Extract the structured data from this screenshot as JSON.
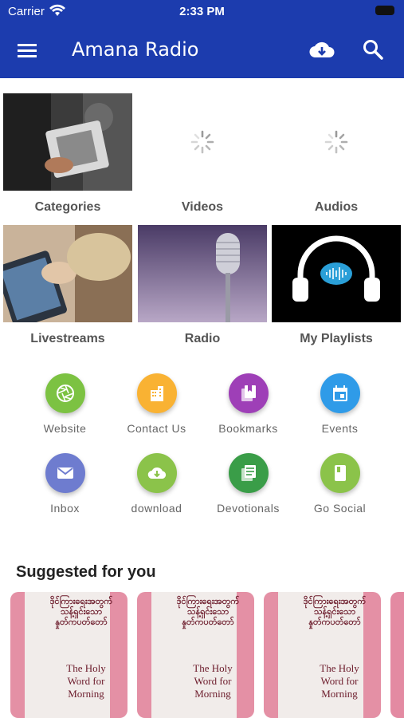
{
  "status_bar": {
    "carrier": "Carrier",
    "time": "2:33 PM"
  },
  "app_bar": {
    "title": "Amana Radio",
    "icons": [
      "menu-icon",
      "cloud-download-icon",
      "search-icon"
    ]
  },
  "tiles": [
    {
      "label": "Categories",
      "image": "person-reading-tablet"
    },
    {
      "label": "Videos",
      "image": "loading-spinner"
    },
    {
      "label": "Audios",
      "image": "loading-spinner"
    },
    {
      "label": "Livestreams",
      "image": "hand-holding-tablet"
    },
    {
      "label": "Radio",
      "image": "microphone"
    },
    {
      "label": "My Playlists",
      "image": "headphones"
    }
  ],
  "quick_actions": [
    {
      "label": "Website",
      "icon": "camera-aperture-icon",
      "color": "#7cc242"
    },
    {
      "label": "Contact Us",
      "icon": "building-icon",
      "color": "#f9b233"
    },
    {
      "label": "Bookmarks",
      "icon": "bookmark-icon",
      "color": "#9e3fb7"
    },
    {
      "label": "Events",
      "icon": "calendar-icon",
      "color": "#2f9be8"
    },
    {
      "label": "Inbox",
      "icon": "mail-icon",
      "color": "#6e7ccf"
    },
    {
      "label": "download",
      "icon": "cloud-download-icon",
      "color": "#8bc34a"
    },
    {
      "label": "Devotionals",
      "icon": "list-icon",
      "color": "#3a9d48"
    },
    {
      "label": "Go Social",
      "icon": "book-icon",
      "color": "#8bc34a"
    }
  ],
  "suggested": {
    "title": "Suggested for you",
    "cards": [
      {
        "headline": "ဒိုင်ကြားရေးအတွက် သန့်ရှင်းသော နှုတ်ကပတ်တော်",
        "caption": "The Holy Word for Morning"
      },
      {
        "headline": "ဒိုင်ကြားရေးအတွက် သန့်ရှင်းသော နှုတ်ကပတ်တော်",
        "caption": "The Holy Word for Morning"
      },
      {
        "headline": "ဒိုင်ကြားရေးအတွက် သန့်ရှင်းသော နှုတ်ကပတ်တော်",
        "caption": "The Holy Word for Morning"
      }
    ]
  },
  "colors": {
    "header": "#1c3cae",
    "label": "#555555"
  }
}
